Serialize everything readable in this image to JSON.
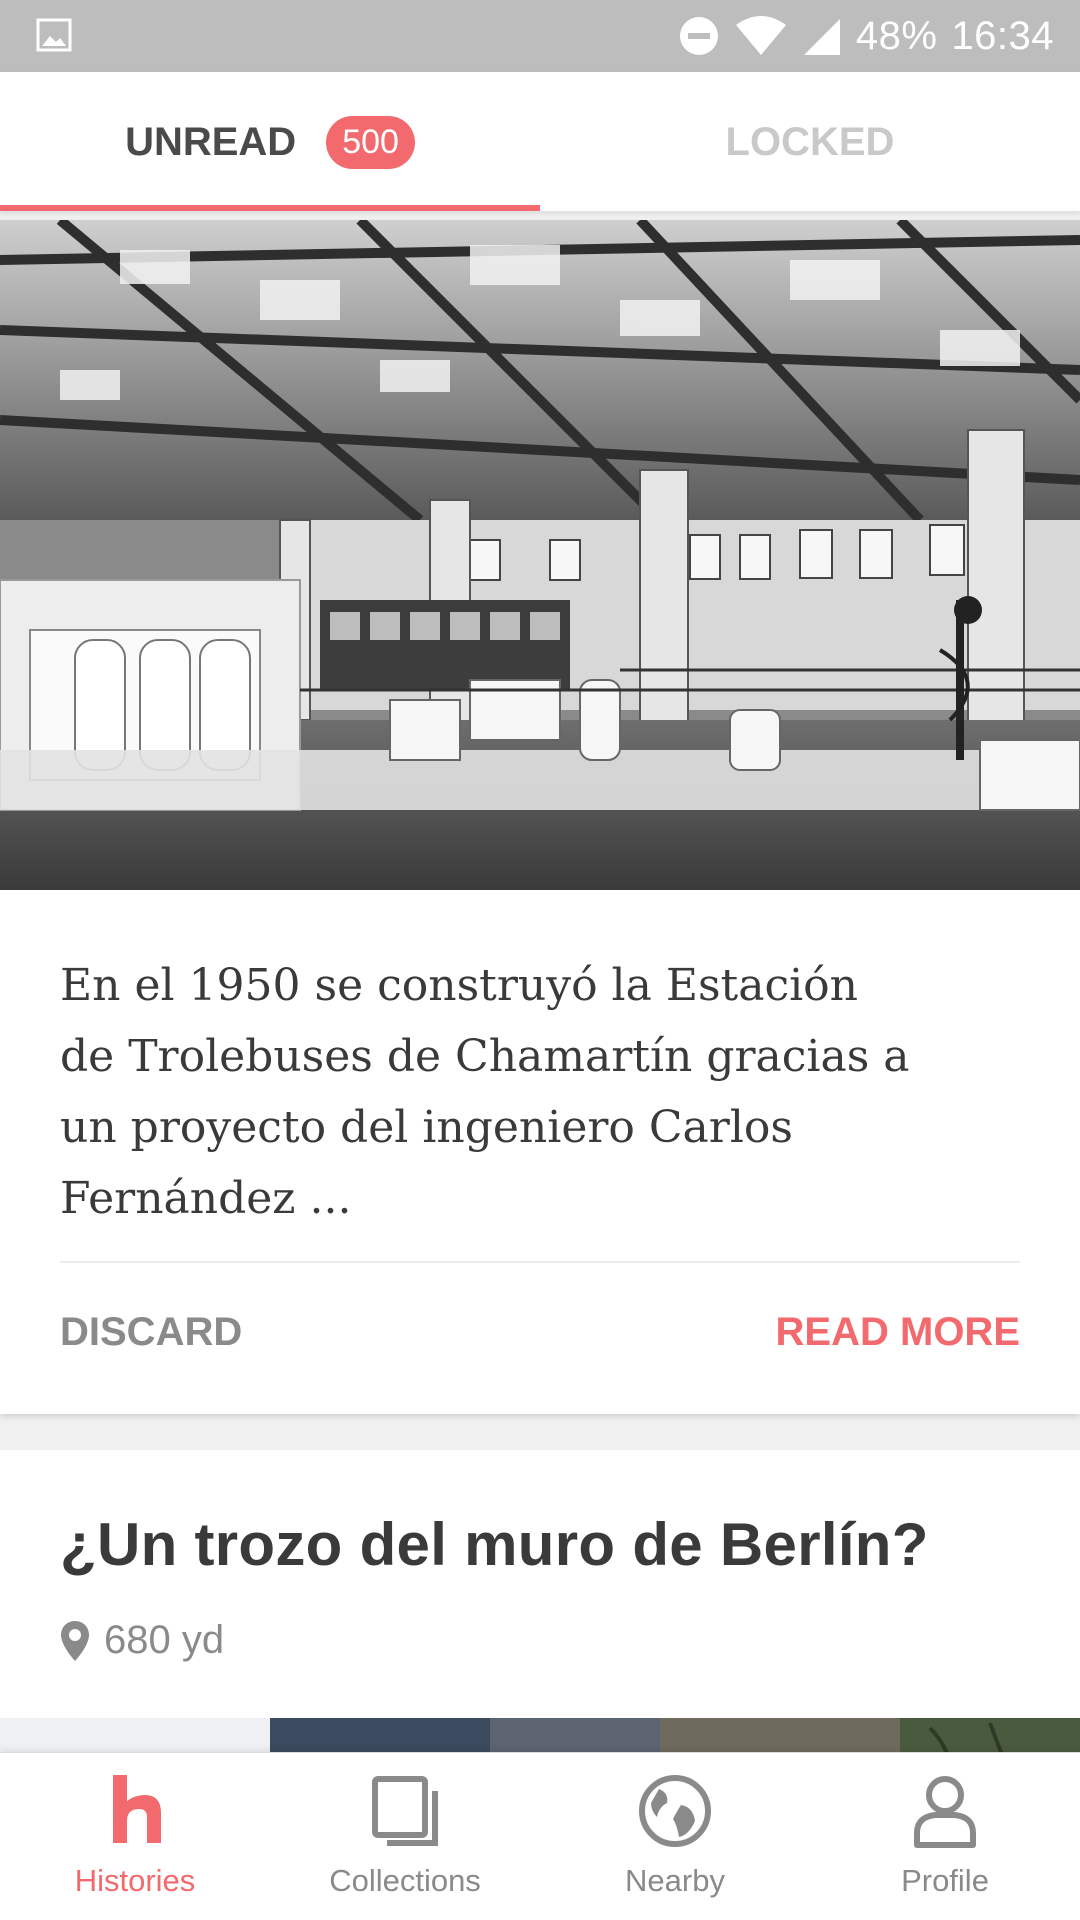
{
  "status_bar": {
    "battery": "48%",
    "time": "16:34"
  },
  "tabs": [
    {
      "label": "UNREAD",
      "badge": "500",
      "active": true
    },
    {
      "label": "LOCKED",
      "active": false
    }
  ],
  "card1": {
    "excerpt": "En el 1950 se construyó la Estación de Trolebuses de Chamartín gracias a un proyecto del ingeniero Carlos Fernández ...",
    "discard_label": "DISCARD",
    "read_more_label": "READ MORE"
  },
  "card2": {
    "title": "¿Un trozo del muro de Berlín?",
    "distance": "680 yd"
  },
  "nav": {
    "items": [
      {
        "label": "Histories",
        "icon": "histories-logo-icon",
        "active": true
      },
      {
        "label": "Collections",
        "icon": "collections-icon",
        "active": false
      },
      {
        "label": "Nearby",
        "icon": "globe-icon",
        "active": false
      },
      {
        "label": "Profile",
        "icon": "profile-icon",
        "active": false
      }
    ]
  },
  "colors": {
    "accent": "#f26a6e",
    "statusbar": "#bdbdbd",
    "text_dark": "#3a3a3a",
    "text_muted": "#8a8a8a"
  }
}
